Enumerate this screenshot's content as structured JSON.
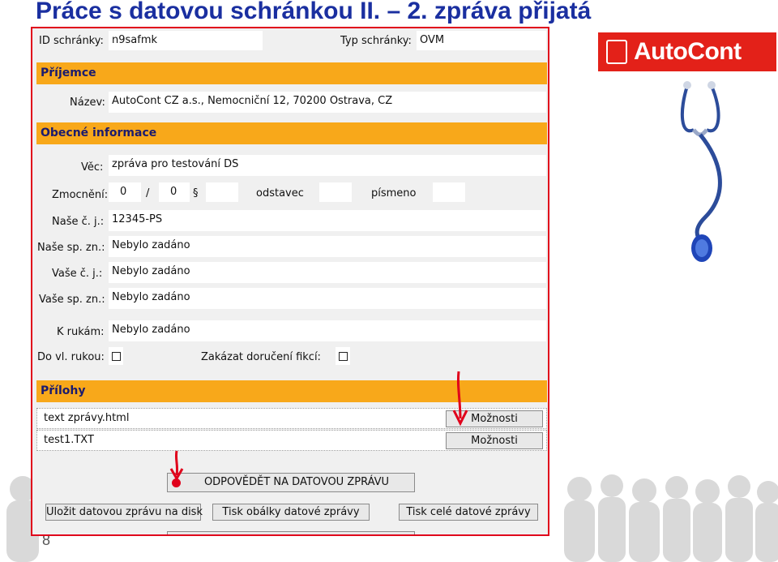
{
  "slide": {
    "title": "Práce s datovou schránkou II. – 2. zpráva přijatá",
    "page_number": "8"
  },
  "logo": {
    "text": "AutoCont"
  },
  "header": {
    "id_label": "ID schránky:",
    "id_value": "n9safmk",
    "type_label": "Typ schránky:",
    "type_value": "OVM"
  },
  "recipient": {
    "section_title": "Příjemce",
    "name_label": "Název:",
    "name_value": "AutoCont CZ a.s., Nemocniční 12, 70200 Ostrava, CZ"
  },
  "general": {
    "section_title": "Obecné informace",
    "subject_label": "Věc:",
    "subject_value": "zpráva pro testování DS",
    "authority_label": "Zmocnění:",
    "authority_num1": "0",
    "authority_sep": "/",
    "authority_num2": "0",
    "paragraph_symbol": "§",
    "paragraph_value": "",
    "odstavec_label": "odstavec",
    "odstavec_value": "",
    "pismeno_label": "písmeno",
    "pismeno_value": "",
    "our_ref_label": "Naše č. j.:",
    "our_ref_value": "12345-PS",
    "our_file_label": "Naše sp. zn.:",
    "our_file_value": "Nebylo zadáno",
    "your_ref_label": "Vaše č. j.:",
    "your_ref_value": "Nebylo zadáno",
    "your_file_label": "Vaše sp. zn.:",
    "your_file_value": "Nebylo zadáno",
    "attention_label": "K rukám:",
    "attention_value": "Nebylo zadáno",
    "personal_label": "Do vl. rukou:",
    "fiction_label": "Zakázat doručení fikcí:"
  },
  "attachments": {
    "section_title": "Přílohy",
    "items": [
      {
        "name": "text zprávy.html",
        "button": "Možnosti"
      },
      {
        "name": "test1.TXT",
        "button": "Možnosti"
      }
    ]
  },
  "actions": {
    "reply": "ODPOVĚDĚT NA DATOVOU ZPRÁVU",
    "save": "Uložit datovou zprávu na disk",
    "print_envelope": "Tisk obálky datové zprávy",
    "print_all": "Tisk celé datové zprávy"
  },
  "colors": {
    "title": "#1a2fa0",
    "band": "#f8a81a",
    "band_text": "#1b1b6e",
    "frame": "#e0001b",
    "logo": "#e32119",
    "arrow": "#e0001b"
  }
}
